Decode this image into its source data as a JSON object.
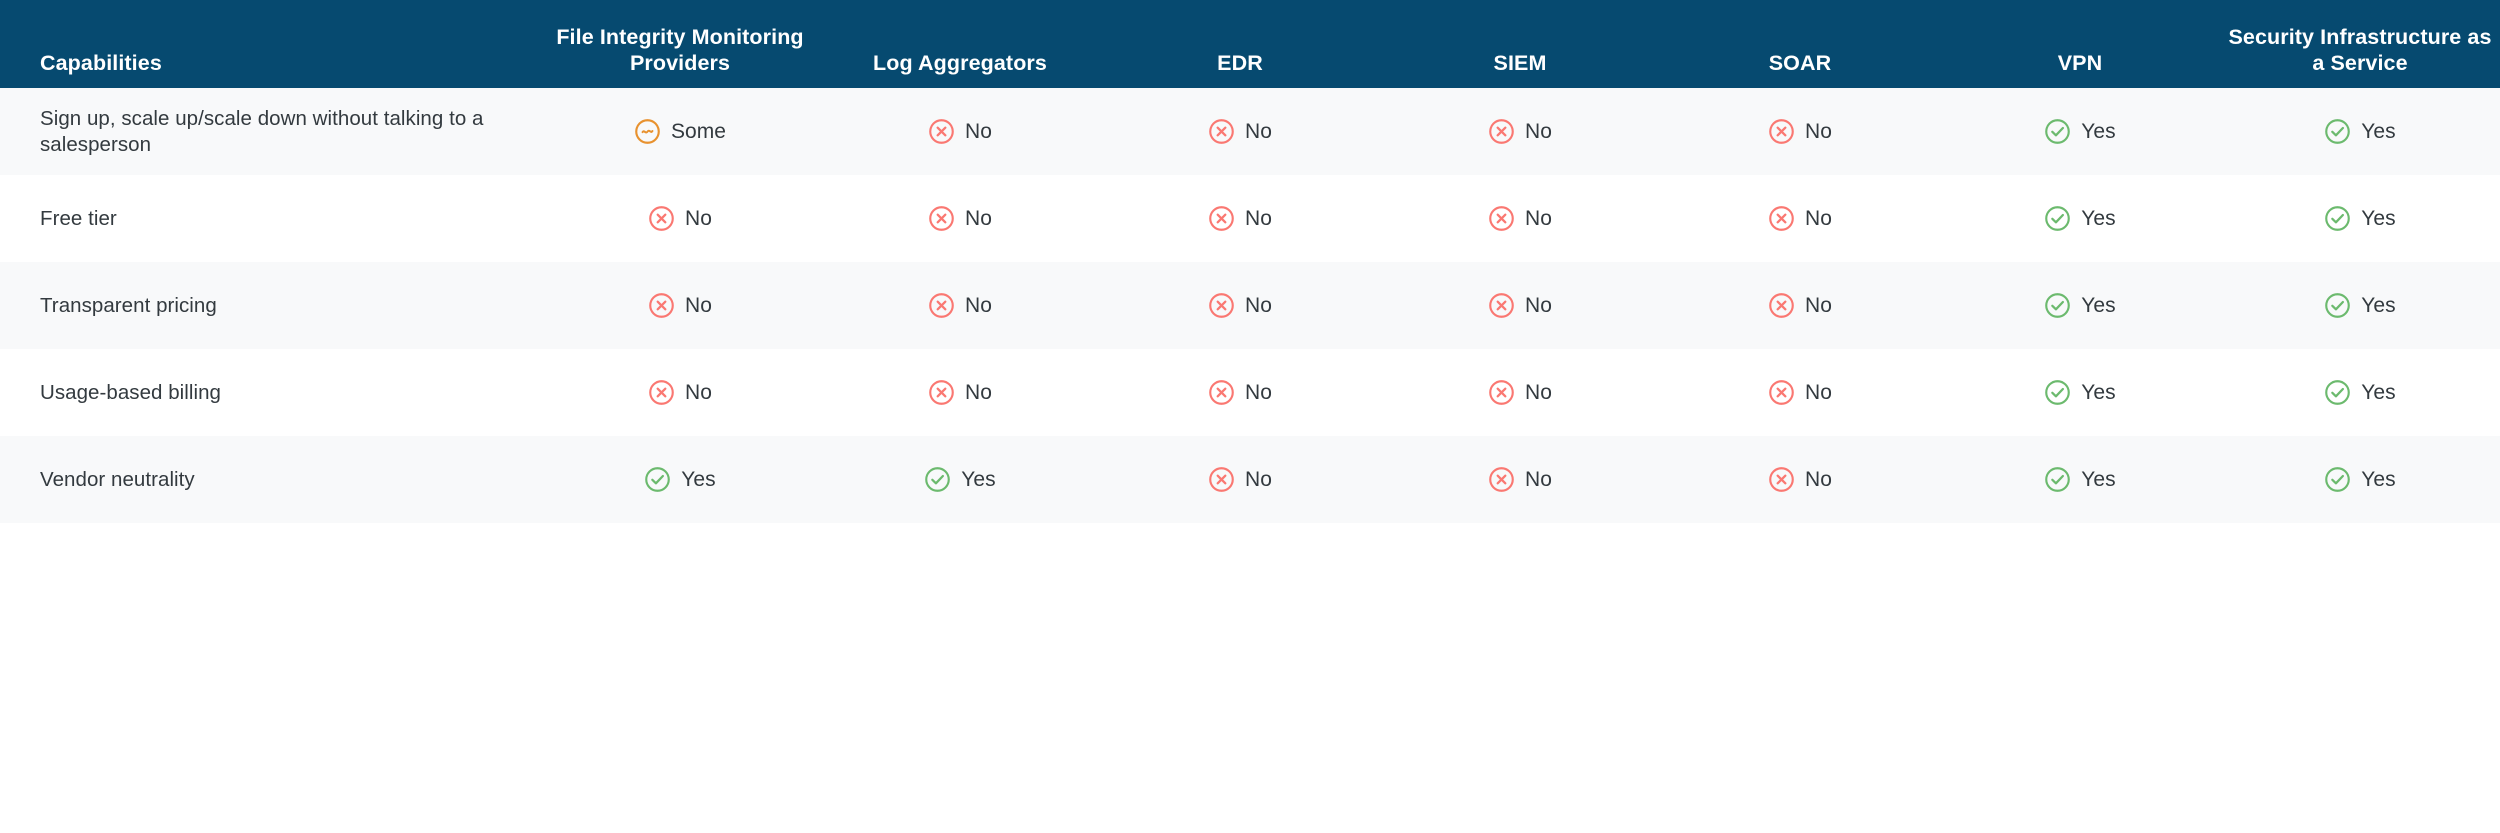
{
  "table": {
    "headers": [
      "Capabilities",
      "File Integrity Monitoring Providers",
      "Log Aggregators",
      "EDR",
      "SIEM",
      "SOAR",
      "VPN",
      "Security Infrastructure as a Service"
    ],
    "rows": [
      {
        "label": "Sign up, scale up/scale down without talking to a salesperson",
        "values": [
          {
            "state": "some",
            "text": "Some"
          },
          {
            "state": "no",
            "text": "No"
          },
          {
            "state": "no",
            "text": "No"
          },
          {
            "state": "no",
            "text": "No"
          },
          {
            "state": "no",
            "text": "No"
          },
          {
            "state": "yes",
            "text": "Yes"
          },
          {
            "state": "yes",
            "text": "Yes"
          }
        ]
      },
      {
        "label": "Free tier",
        "values": [
          {
            "state": "no",
            "text": "No"
          },
          {
            "state": "no",
            "text": "No"
          },
          {
            "state": "no",
            "text": "No"
          },
          {
            "state": "no",
            "text": "No"
          },
          {
            "state": "no",
            "text": "No"
          },
          {
            "state": "yes",
            "text": "Yes"
          },
          {
            "state": "yes",
            "text": "Yes"
          }
        ]
      },
      {
        "label": "Transparent pricing",
        "values": [
          {
            "state": "no",
            "text": "No"
          },
          {
            "state": "no",
            "text": "No"
          },
          {
            "state": "no",
            "text": "No"
          },
          {
            "state": "no",
            "text": "No"
          },
          {
            "state": "no",
            "text": "No"
          },
          {
            "state": "yes",
            "text": "Yes"
          },
          {
            "state": "yes",
            "text": "Yes"
          }
        ]
      },
      {
        "label": "Usage-based billing",
        "values": [
          {
            "state": "no",
            "text": "No"
          },
          {
            "state": "no",
            "text": "No"
          },
          {
            "state": "no",
            "text": "No"
          },
          {
            "state": "no",
            "text": "No"
          },
          {
            "state": "no",
            "text": "No"
          },
          {
            "state": "yes",
            "text": "Yes"
          },
          {
            "state": "yes",
            "text": "Yes"
          }
        ]
      },
      {
        "label": "Vendor neutrality",
        "values": [
          {
            "state": "yes",
            "text": "Yes"
          },
          {
            "state": "yes",
            "text": "Yes"
          },
          {
            "state": "no",
            "text": "No"
          },
          {
            "state": "no",
            "text": "No"
          },
          {
            "state": "no",
            "text": "No"
          },
          {
            "state": "yes",
            "text": "Yes"
          },
          {
            "state": "yes",
            "text": "Yes"
          }
        ]
      }
    ]
  },
  "icons": {
    "yes": "check-circle-icon",
    "no": "x-circle-icon",
    "some": "tilde-circle-icon"
  },
  "colors": {
    "header_background": "#064a70",
    "header_text": "#ffffff",
    "row_stripe": "#f8f9fa",
    "row_plain": "#ffffff",
    "body_text": "#333a3f",
    "yes_icon": "#6cba6e",
    "no_icon": "#fa7872",
    "some_icon": "#e8922f"
  }
}
